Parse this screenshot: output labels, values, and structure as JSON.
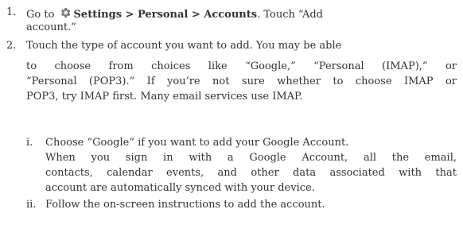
{
  "steps": [
    {
      "number": "1.",
      "line1_prefix": "Go to",
      "gear_icon": "gear-icon",
      "line1_bold": "Settings > Personal > Accounts",
      "line1_suffix": ". Touch “Add",
      "line2": "account.”"
    },
    {
      "number": "2.",
      "line1": "Touch the type of account you want to add. You may be able",
      "line2": "to choose from choices like “Google,” “Personal (IMAP),” or",
      "line3": "“Personal (POP3).” If you’re not sure whether to choose IMAP or",
      "line4": "POP3, try IMAP first. Many email services use IMAP."
    }
  ],
  "substeps": [
    {
      "number": "i.",
      "line1": "Choose “Google” if you want to add your Google Account.",
      "line2": "When you sign in with a Google Account, all the email,",
      "line3": "contacts, calendar events, and other data associated with that",
      "line4": "account are automatically synced with your device."
    },
    {
      "number": "ii.",
      "line1": "Follow the on-screen instructions to add the account."
    }
  ]
}
